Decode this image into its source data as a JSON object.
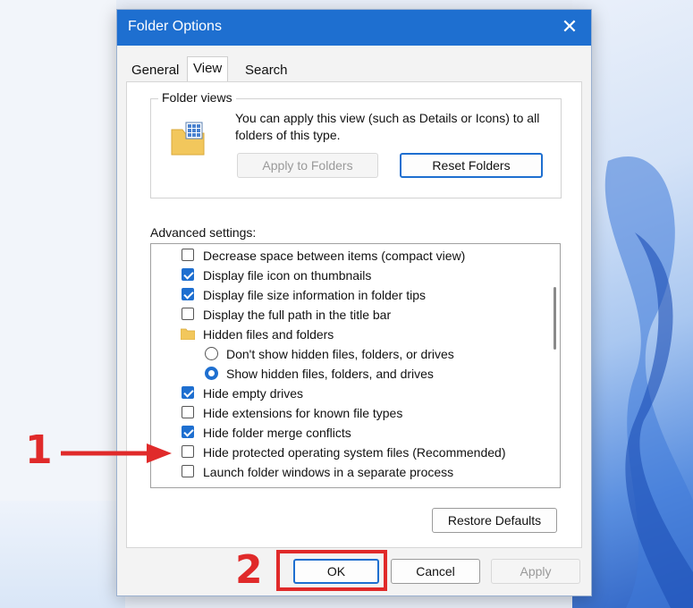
{
  "window": {
    "title": "Folder Options",
    "close_glyph": "✕"
  },
  "tabs": [
    {
      "label": "General"
    },
    {
      "label": "View",
      "active": true
    },
    {
      "label": "Search"
    }
  ],
  "folder_views": {
    "legend": "Folder views",
    "description": "You can apply this view (such as Details or Icons) to all folders of this type.",
    "apply_button": "Apply to Folders",
    "reset_button": "Reset Folders"
  },
  "advanced": {
    "label": "Advanced settings:",
    "items": [
      {
        "label": "Decrease space between items (compact view)",
        "type": "checkbox",
        "checked": false
      },
      {
        "label": "Display file icon on thumbnails",
        "type": "checkbox",
        "checked": true
      },
      {
        "label": "Display file size information in folder tips",
        "type": "checkbox",
        "checked": true
      },
      {
        "label": "Display the full path in the title bar",
        "type": "checkbox",
        "checked": false
      },
      {
        "label": "Hidden files and folders",
        "type": "folder"
      },
      {
        "label": "Don't show hidden files, folders, or drives",
        "type": "radio",
        "selected": false
      },
      {
        "label": "Show hidden files, folders, and drives",
        "type": "radio",
        "selected": true
      },
      {
        "label": "Hide empty drives",
        "type": "checkbox",
        "checked": true
      },
      {
        "label": "Hide extensions for known file types",
        "type": "checkbox",
        "checked": false
      },
      {
        "label": "Hide folder merge conflicts",
        "type": "checkbox",
        "checked": true
      },
      {
        "label": "Hide protected operating system files (Recommended)",
        "type": "checkbox",
        "checked": false
      },
      {
        "label": "Launch folder windows in a separate process",
        "type": "checkbox",
        "checked": false
      }
    ],
    "restore_button": "Restore Defaults"
  },
  "footer": {
    "ok": "OK",
    "cancel": "Cancel",
    "apply": "Apply"
  },
  "annotations": {
    "step1": "1",
    "step2": "2",
    "color": "#e02a2a"
  },
  "colors": {
    "accent": "#1e6fd0"
  }
}
